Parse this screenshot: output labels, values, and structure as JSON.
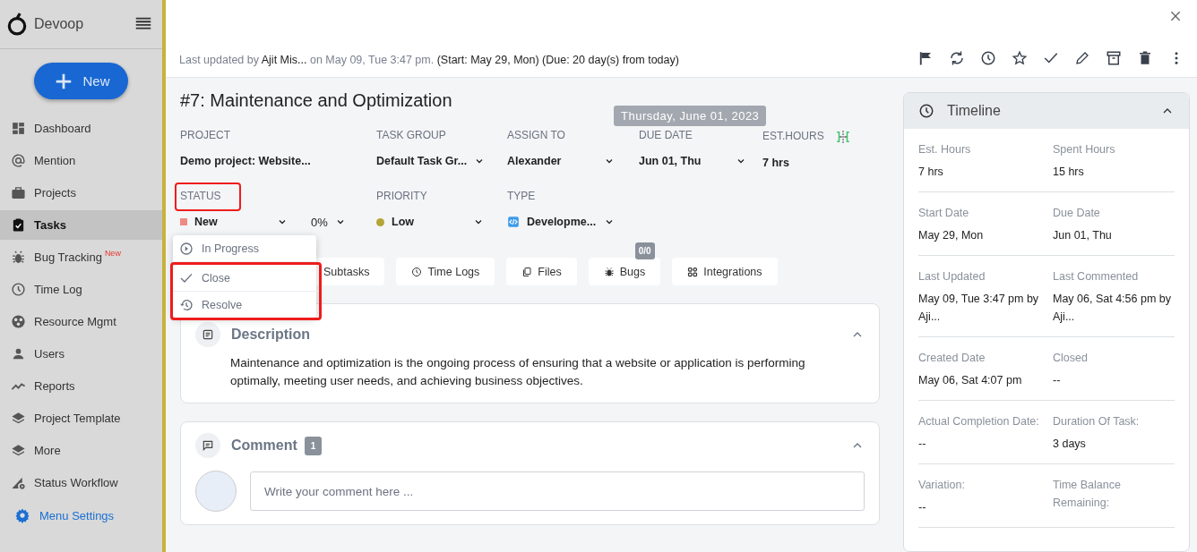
{
  "sidebar": {
    "brand": "Devoop",
    "new_button": "New",
    "items": [
      {
        "label": "Dashboard",
        "selected": false
      },
      {
        "label": "Mention",
        "selected": false
      },
      {
        "label": "Projects",
        "selected": false
      },
      {
        "label": "Tasks",
        "selected": true
      },
      {
        "label": "Bug Tracking",
        "selected": false,
        "badge": "New"
      },
      {
        "label": "Time Log",
        "selected": false
      },
      {
        "label": "Resource Mgmt",
        "selected": false
      },
      {
        "label": "Users",
        "selected": false
      },
      {
        "label": "Reports",
        "selected": false
      },
      {
        "label": "Project Template",
        "selected": false
      },
      {
        "label": "More",
        "selected": false
      },
      {
        "label": "Status Workflow",
        "selected": false
      }
    ],
    "settings_link": "Menu Settings"
  },
  "header": {
    "info": "Last updated by **Ajit Mis...** on May 09, Tue 3:47 pm. **(Start: May 29, Mon) (Due: 20 day(s) from today)**"
  },
  "task": {
    "title": "#7: Maintenance and Optimization",
    "fields": [
      {
        "label": "PROJECT",
        "value": "Demo project: Website...",
        "kind": "text"
      },
      {
        "label": "TASK GROUP",
        "value": "Default Task Gr...",
        "kind": "select"
      },
      {
        "label": "ASSIGN TO",
        "value": "Alexander",
        "kind": "select"
      },
      {
        "label": "DUE DATE",
        "value": "Jun 01, Thu",
        "kind": "select",
        "tooltip": "Thursday, June 01, 2023"
      },
      {
        "label": "EST.HOURS",
        "value": "7 hrs",
        "kind": "hours"
      }
    ],
    "fields_2": [
      {
        "label": "STATUS",
        "value": "New",
        "kind": "status",
        "color": "#f08a84",
        "highlighted": true,
        "progress": "0%"
      },
      {
        "label": "PRIORITY",
        "value": "Low",
        "kind": "priority",
        "color": "#b3a536"
      },
      {
        "label": "TYPE",
        "value": "Developme...",
        "kind": "type"
      }
    ]
  },
  "status_menu": [
    {
      "label": "In Progress",
      "highlighted": false
    },
    {
      "label": "Close",
      "highlighted": true
    },
    {
      "label": "Resolve",
      "highlighted": true
    }
  ],
  "tabs": [
    {
      "label": "Subtasks",
      "selected": false
    },
    {
      "label": "Time Logs",
      "selected": false
    },
    {
      "label": "Files",
      "selected": false
    },
    {
      "label": "Bugs",
      "selected": false,
      "badge": "0/0"
    },
    {
      "label": "Integrations",
      "selected": false
    }
  ],
  "description": {
    "title": "Description",
    "text": "Maintenance and optimization is the ongoing process of ensuring that a website or application is performing optimally, meeting user needs, and achieving business objectives."
  },
  "comment": {
    "title": "Comment",
    "count": "1",
    "placeholder": "Write your comment here ..."
  },
  "timeline": {
    "title": "Timeline",
    "rows": [
      {
        "cells": [
          {
            "label": "Est. Hours",
            "value": "7 hrs"
          },
          {
            "label": "Spent Hours",
            "value": "15 hrs"
          }
        ]
      },
      {
        "cells": [
          {
            "label": "Start Date",
            "value": "May 29, Mon"
          },
          {
            "label": "Due Date",
            "value": "Jun 01, Thu"
          }
        ]
      },
      {
        "cells": [
          {
            "label": "Last Updated",
            "value": "May 09, Tue 3:47 pm by Aji..."
          },
          {
            "label": "Last Commented",
            "value": "May 06, Sat 4:56 pm by Aji..."
          }
        ]
      },
      {
        "cells": [
          {
            "label": "Created Date",
            "value": "May 06, Sat 4:07 pm"
          },
          {
            "label": "Closed",
            "value": "--"
          }
        ]
      },
      {
        "cells": [
          {
            "label": "Actual Completion Date:",
            "value": "--"
          },
          {
            "label": "Duration Of Task:",
            "value": "3 days"
          }
        ]
      },
      {
        "cells": [
          {
            "label": "Variation:",
            "value": "--"
          },
          {
            "label": "Time Balance Remaining:"
          }
        ]
      }
    ]
  }
}
